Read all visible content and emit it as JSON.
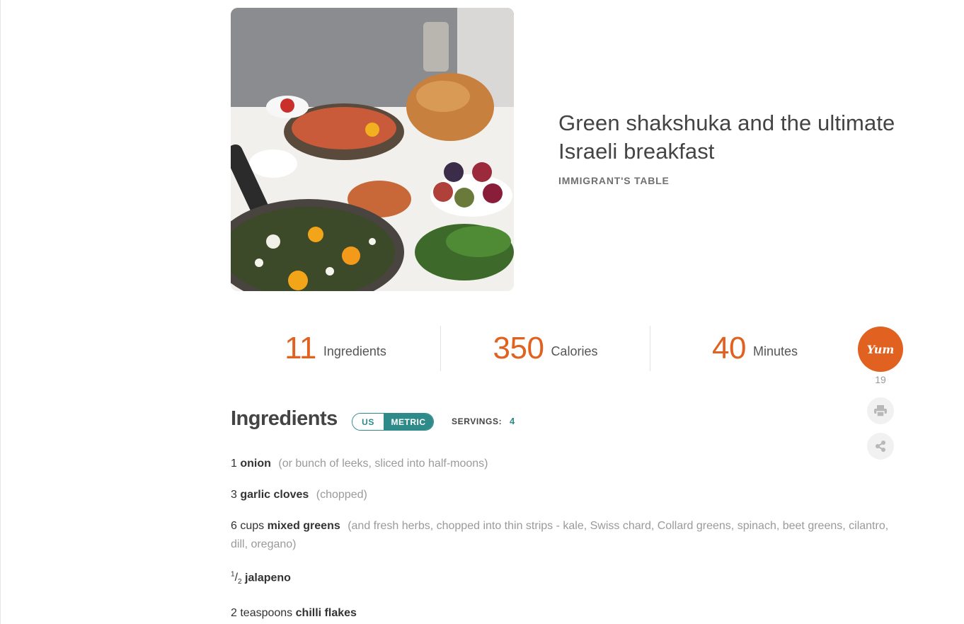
{
  "recipe": {
    "title": "Green shakshuka and the ultimate Israeli breakfast",
    "source": "IMMIGRANT'S TABLE",
    "image_alt": "Green shakshuka pan with Israeli breakfast spread"
  },
  "stats": [
    {
      "value": "11",
      "label": "Ingredients"
    },
    {
      "value": "350",
      "label": "Calories"
    },
    {
      "value": "40",
      "label": "Minutes"
    }
  ],
  "actions": {
    "yum_label": "Yum",
    "yum_count": "19",
    "print_icon": "print-icon",
    "share_icon": "share-icon"
  },
  "ingredients_section": {
    "heading": "Ingredients",
    "unit_us": "US",
    "unit_metric": "METRIC",
    "active_unit": "METRIC",
    "servings_label": "SERVINGS:",
    "servings_value": "4"
  },
  "ingredients": [
    {
      "qty": "1",
      "name": "onion",
      "note": "(or bunch of leeks, sliced into half-moons)"
    },
    {
      "qty": "3",
      "name": "garlic cloves",
      "note": "(chopped)"
    },
    {
      "qty": "6 cups",
      "name": "mixed greens",
      "note": "(and fresh herbs, chopped into thin strips - kale, Swiss chard, Collard greens, spinach, beet greens, cilantro, dill, oregano)"
    },
    {
      "qty_num": "1",
      "qty_den": "2",
      "name": "jalapeno",
      "note": ""
    },
    {
      "qty": "2 teaspoons",
      "name": "chilli flakes",
      "note": ""
    }
  ],
  "colors": {
    "accent": "#e16120",
    "teal": "#2f8a8a",
    "muted": "#9a9a9a"
  }
}
